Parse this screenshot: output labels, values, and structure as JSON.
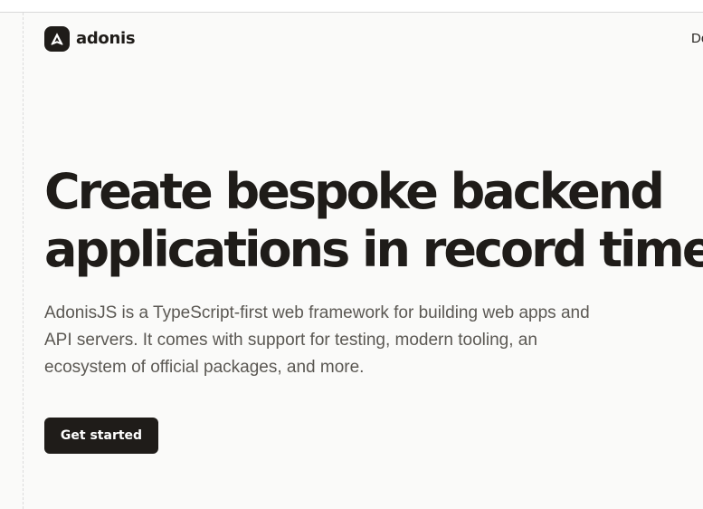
{
  "brand": {
    "name": "adonis",
    "logo_icon": "adonis-a-logo-icon",
    "color": "#1f1c19"
  },
  "nav": {
    "cut_off_label": "Do"
  },
  "hero": {
    "title_lines": [
      "Create bespoke backend",
      "applications in record time"
    ],
    "description_lines": [
      "AdonisJS is a TypeScript-first web framework for building web apps and",
      "API servers. It comes with support for testing, modern tooling, an",
      "ecosystem of official packages, and more."
    ],
    "cta_label": "Get started"
  },
  "colors": {
    "background": "#fafaf9",
    "text_primary": "#1f1c19",
    "text_secondary": "#5b5853",
    "button_bg": "#1f1c19",
    "button_text": "#ffffff"
  }
}
